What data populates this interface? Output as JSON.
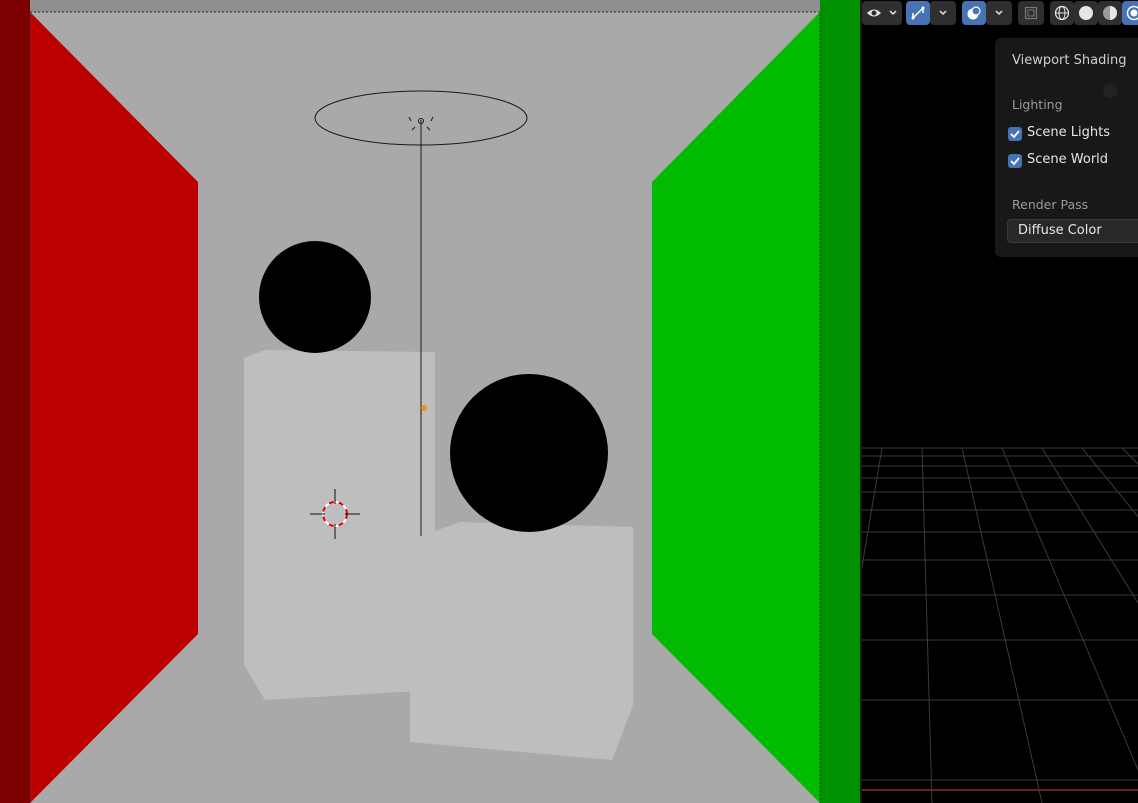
{
  "viewport": {
    "wall_left_color": "#bc0000",
    "wall_right_color": "#00bb00",
    "backdrop_color": "#a9a9a9",
    "box_color": "#bebebe",
    "sphere_color": "#000000"
  },
  "header": {
    "icons": [
      "eye-icon",
      "gizmo-icon",
      "overlay-icon",
      "xray-icon",
      "wireframe-shading-icon",
      "solid-shading-icon",
      "material-shading-icon",
      "rendered-shading-icon"
    ]
  },
  "shading_popover": {
    "title": "Viewport Shading",
    "lighting_label": "Lighting",
    "scene_lights_label": "Scene Lights",
    "scene_lights_checked": true,
    "scene_world_label": "Scene World",
    "scene_world_checked": true,
    "render_pass_label": "Render Pass",
    "render_pass_value": "Diffuse Color"
  }
}
